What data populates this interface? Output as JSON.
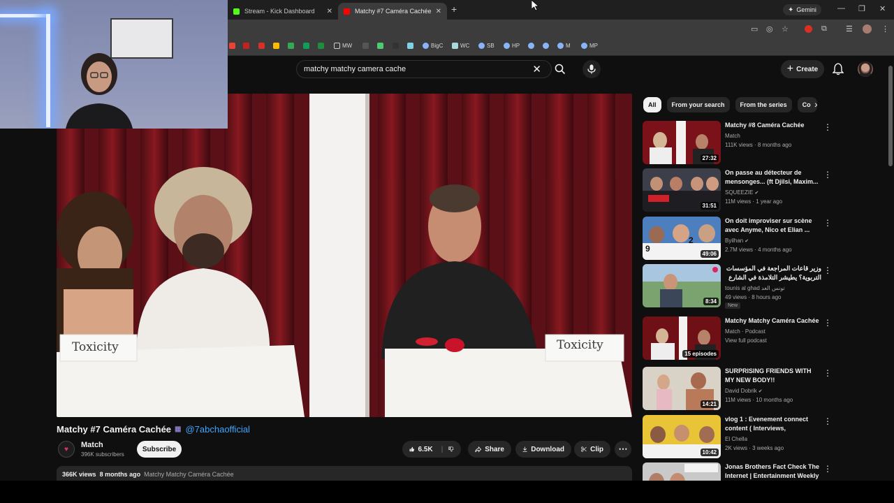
{
  "browser": {
    "tabs": [
      {
        "label": "Stream - Kick Dashboard",
        "active": false,
        "favicon_color": "#53fc18"
      },
      {
        "label": "Matchy #7 Caméra Cachée",
        "active": true,
        "favicon_color": "#ff0000"
      }
    ],
    "gemini_label": "Gemini",
    "bookmarks": [
      "MW",
      "BigC",
      "WC",
      "SB",
      "HP",
      "M",
      "MP"
    ]
  },
  "youtube": {
    "search_value": "matchy matchy camera cache",
    "create_label": "Create"
  },
  "video": {
    "title": "Matchy #7 Caméra Cachée",
    "hashtag": "@7abchaofficial",
    "sign_left": "Toxicity",
    "sign_right": "Toxicity",
    "channel": "Match",
    "subscribers": "396K subscribers",
    "subscribe_label": "Subscribe",
    "likes": "6.5K",
    "share_label": "Share",
    "download_label": "Download",
    "clip_label": "Clip",
    "views": "366K views",
    "age": "8 months ago",
    "series": "Matchy Matchy Caméra Cachée"
  },
  "chips": [
    "All",
    "From your search",
    "From the series",
    "Co"
  ],
  "recommendations": [
    {
      "title": "Matchy #8 Caméra Cachée",
      "channel": "Match",
      "meta": "111K views · 8 months ago",
      "duration": "27:32",
      "verified": false
    },
    {
      "title": "On passe au détecteur de mensonges... (ft Djilsi, Maxim...",
      "channel": "SQUEEZIE",
      "meta": "11M views · 1 year ago",
      "duration": "31:51",
      "verified": true
    },
    {
      "title": "On doit improviser sur scène avec Anyme, Nico et Elian ...",
      "channel": "Byilhan",
      "meta": "2.7M views · 4 months ago",
      "duration": "49:06",
      "verified": true
    },
    {
      "title": "وزير قاعات المراجعة في المؤسسات التربوية؟ يطيشر التلامذة في الشارع في أحصاني ...",
      "channel": "tounis al ghad تونس الغد",
      "meta": "49 views · 8 hours ago",
      "duration": "8:34",
      "verified": false,
      "new": "New"
    },
    {
      "title": "Matchy Matchy Caméra Cachée",
      "channel": "Match · Podcast",
      "meta": "View full podcast",
      "duration": "15 episodes",
      "verified": false
    },
    {
      "title": "SURPRISING FRIENDS WITH MY NEW BODY!!",
      "channel": "David Dobrik",
      "meta": "11M views · 10 months ago",
      "duration": "14:21",
      "verified": true
    },
    {
      "title": "vlog 1 : Evenement connect content ( Interviews, Activities,...",
      "channel": "El Chella",
      "meta": "2K views · 3 weeks ago",
      "duration": "10:42",
      "verified": false
    },
    {
      "title": "Jonas Brothers Fact Check The Internet | Entertainment Weekly",
      "channel": "",
      "meta": "",
      "duration": "",
      "verified": false
    }
  ]
}
